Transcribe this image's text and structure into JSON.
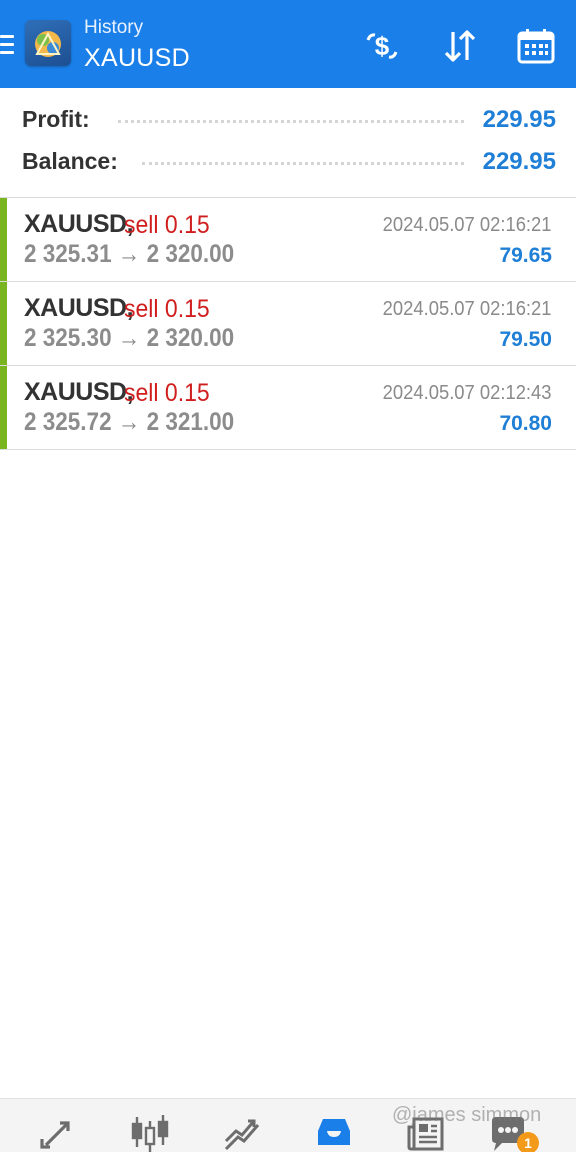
{
  "header": {
    "subtitle": "History",
    "symbol": "XAUUSD",
    "icons": [
      "menu-icon",
      "app-logo",
      "deposit-dollar-icon",
      "sort-icon",
      "calendar-icon"
    ]
  },
  "summary": {
    "profit_label": "Profit:",
    "profit_value": "229.95",
    "balance_label": "Balance:",
    "balance_value": "229.95"
  },
  "deals": [
    {
      "symbol": "XAUUSD,",
      "side": "sell 0.15",
      "time": "2024.05.07 02:16:21",
      "prices": "2 325.31 → 2 320.00",
      "profit": "79.65"
    },
    {
      "symbol": "XAUUSD,",
      "side": "sell 0.15",
      "time": "2024.05.07 02:16:21",
      "prices": "2 325.30 → 2 320.00",
      "profit": "79.50"
    },
    {
      "symbol": "XAUUSD,",
      "side": "sell 0.15",
      "time": "2024.05.07 02:12:43",
      "prices": "2 325.72 → 2 321.00",
      "profit": "70.80"
    }
  ],
  "bottom_nav": {
    "items": [
      "quotes-icon",
      "chart-icon",
      "trade-icon",
      "history-icon",
      "news-icon",
      "chat-icon"
    ],
    "active": "history-icon",
    "chat_badge": "1"
  },
  "watermark": "@james simmon",
  "colors": {
    "appbar": "#1a7fe8",
    "profit_blue": "#1f7fd6",
    "sell_red": "#d01e1e",
    "deal_bar_green": "#78b51f",
    "badge_orange": "#f39a1b"
  }
}
